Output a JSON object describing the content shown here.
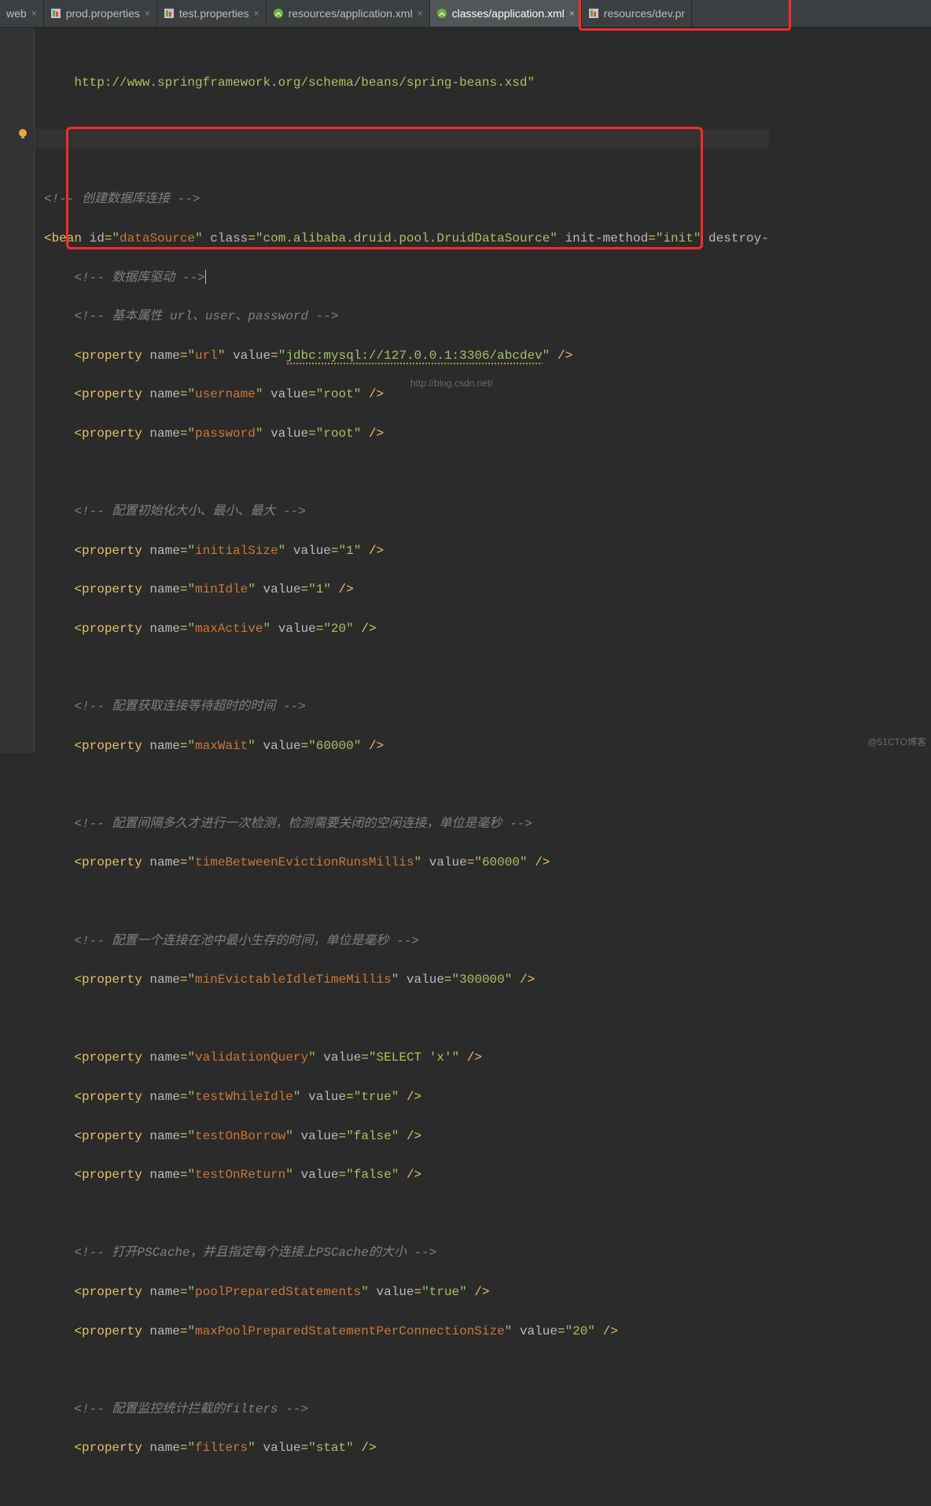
{
  "tabs": [
    {
      "label": "web",
      "icon": "properties",
      "close": true,
      "trunc_left": true
    },
    {
      "label": "prod.properties",
      "icon": "properties",
      "close": true
    },
    {
      "label": "test.properties",
      "icon": "properties",
      "close": true
    },
    {
      "label": "resources/application.xml",
      "icon": "spring-xml",
      "close": true
    },
    {
      "label": "classes/application.xml",
      "icon": "spring-xml",
      "close": true,
      "active": true
    },
    {
      "label": "resources/dev.pr",
      "icon": "properties",
      "close": false,
      "trunc_right": true
    }
  ],
  "code": {
    "schemaLine": "http://www.springframework.org/schema/beans/spring-beans.xsd\"",
    "comments": {
      "createDb": "<!-- 创建数据库连接 -->",
      "dbDriver": "<!-- 数据库驱动 -->",
      "basicProps": "<!-- 基本属性 url、user、password -->",
      "initSize": "<!-- 配置初始化大小、最小、最大 -->",
      "maxWait": "<!-- 配置获取连接等待超时的时间 -->",
      "evictInterval": "<!-- 配置间隔多久才进行一次检测，检测需要关闭的空闲连接，单位是毫秒 -->",
      "minEvict": "<!-- 配置一个连接在池中最小生存的时间，单位是毫秒 -->",
      "pscache": "<!-- 打开PSCache，并且指定每个连接上PSCache的大小 -->",
      "filters": "<!-- 配置监控统计拦截的filters -->"
    },
    "bean": {
      "tag": "bean",
      "id": "dataSource",
      "class": "com.alibaba.druid.pool.DruidDataSource",
      "initMethod": "init",
      "destroyAttr": "destroy-"
    },
    "props": {
      "url": {
        "name": "url",
        "value": "jdbc:mysql://127.0.0.1:3306/abcdev"
      },
      "username": {
        "name": "username",
        "value": "root"
      },
      "password": {
        "name": "password",
        "value": "root"
      },
      "initialSize": {
        "name": "initialSize",
        "value": "1"
      },
      "minIdle": {
        "name": "minIdle",
        "value": "1"
      },
      "maxActive": {
        "name": "maxActive",
        "value": "20"
      },
      "maxWait": {
        "name": "maxWait",
        "value": "60000"
      },
      "timeBetween": {
        "name": "timeBetweenEvictionRunsMillis",
        "value": "60000"
      },
      "minEvict": {
        "name": "minEvictableIdleTimeMillis",
        "value": "300000"
      },
      "valQuery": {
        "name": "validationQuery",
        "value": "SELECT 'x'"
      },
      "testIdle": {
        "name": "testWhileIdle",
        "value": "true"
      },
      "testBorrow": {
        "name": "testOnBorrow",
        "value": "false"
      },
      "testReturn": {
        "name": "testOnReturn",
        "value": "false"
      },
      "poolPrep": {
        "name": "poolPreparedStatements",
        "value": "true"
      },
      "maxPrep": {
        "name": "maxPoolPreparedStatementPerConnectionSize",
        "value": "20"
      },
      "filters": {
        "name": "filters",
        "value": "stat"
      }
    }
  },
  "watermarks": {
    "csdn": "http://blog.csdn.net/",
    "cto": "@51CTO博客"
  }
}
